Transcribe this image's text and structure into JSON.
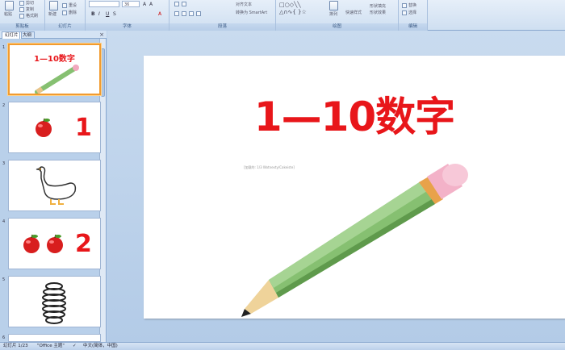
{
  "ribbon": {
    "clipboard": {
      "paste": "粘贴",
      "cut": "剪切",
      "copy": "复制",
      "format_painter": "格式刷",
      "label": "剪贴板"
    },
    "slides": {
      "new_slide": "新建",
      "reset": "重设",
      "delete": "删除",
      "label": "幻灯片"
    },
    "font": {
      "size": "36",
      "label": "字体"
    },
    "paragraph": {
      "align_text": "对齐文本",
      "smartart": "转换为 SmartArt",
      "label": "段落"
    },
    "drawing": {
      "arrange": "排列",
      "quick_styles": "快速样式",
      "shape_fill": "形状填充",
      "shape_effects": "形状效果",
      "label": "绘图"
    },
    "editing": {
      "replace": "替换",
      "select": "选择",
      "label": "编辑"
    }
  },
  "pane": {
    "tab_slides": "幻灯片",
    "tab_outline": "大纲",
    "close": "×",
    "thumbnails": [
      {
        "num": "1",
        "title": "1—10数字"
      },
      {
        "num": "2",
        "digit": "1"
      },
      {
        "num": "3"
      },
      {
        "num": "4",
        "digit": "2"
      },
      {
        "num": "5"
      },
      {
        "num": "6"
      }
    ]
  },
  "slide": {
    "title": "1—10数字",
    "subtext": "[加载的: 1/3 Wotnexty/Cakeiste]"
  },
  "status": {
    "slide_pos": "幻灯片 1/23",
    "theme": "\"Office 主题\"",
    "language": "中文(简体，中国)"
  },
  "colors": {
    "title_red": "#e8161a",
    "selection_border": "#f29b2f",
    "pencil_green": "#86c071"
  }
}
